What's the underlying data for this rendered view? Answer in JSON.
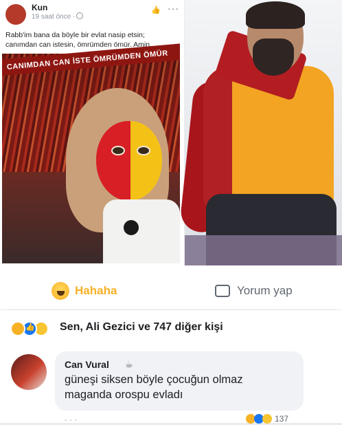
{
  "post": {
    "author": "Kun",
    "meta": "19 saat önce ·",
    "more": "···",
    "text": "Rabb'im bana da böyle bir evlat nasip etsin;\ncanımdan can istesin, ömrümden ömür. Amin.",
    "banner": "CANIMDAN CAN İSTE ÖMRÜMDEN ÖMÜR"
  },
  "actions": {
    "reaction_label": "Hahaha",
    "comment_label": "Yorum yap"
  },
  "summary": {
    "text": "Sen, Ali Gezici ve 747 diğer kişi"
  },
  "comment": {
    "author": "Can Vural",
    "author_icon": "☕",
    "text": "güneşi siksen böyle çocuğun olmaz\nmaganda orospu evladı",
    "reaction_count": "137",
    "links": "· · ·"
  },
  "colors": {
    "haha": "#f7b125",
    "like_blue": "#1877f2",
    "text_primary": "#1c1e21",
    "text_secondary": "#606770",
    "galatasaray_red": "#b31d22",
    "galatasaray_yellow": "#f2a422"
  }
}
